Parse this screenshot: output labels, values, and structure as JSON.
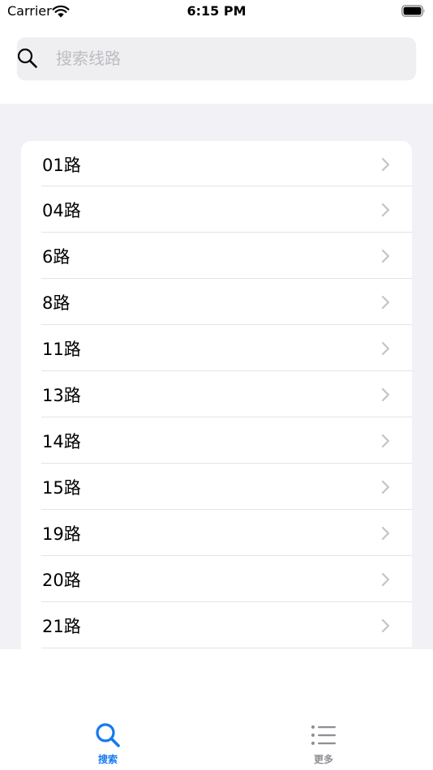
{
  "status_bar": {
    "carrier": "Carrier",
    "time": "6:15 PM"
  },
  "search": {
    "placeholder": "搜索线路",
    "value": ""
  },
  "routes": [
    "01路",
    "04路",
    "6路",
    "8路",
    "11路",
    "13路",
    "14路",
    "15路",
    "19路",
    "20路",
    "21路"
  ],
  "tab_bar": {
    "tabs": [
      {
        "label": "搜索",
        "icon": "search-icon",
        "active": true
      },
      {
        "label": "更多",
        "icon": "list-icon",
        "active": false
      }
    ]
  },
  "colors": {
    "accent": "#1479f0",
    "inactive_tab": "#8e8e93",
    "background_grouped": "#f1f1f6",
    "search_field": "#efeff1",
    "placeholder": "#bdbdc2",
    "chevron": "#c4c4c7"
  }
}
